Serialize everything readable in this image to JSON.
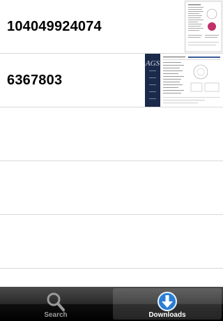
{
  "downloads": [
    {
      "id": "104049924074",
      "thumbnail": "gia-certificate"
    },
    {
      "id": "6367803",
      "thumbnail": "ags-certificate"
    }
  ],
  "ags_logo": "AGS",
  "tabbar": {
    "tabs": [
      {
        "label": "Search",
        "icon": "magnifier",
        "selected": false
      },
      {
        "label": "Downloads",
        "icon": "download-arrow",
        "selected": true
      }
    ],
    "selected_color": "#2a7fd4"
  }
}
